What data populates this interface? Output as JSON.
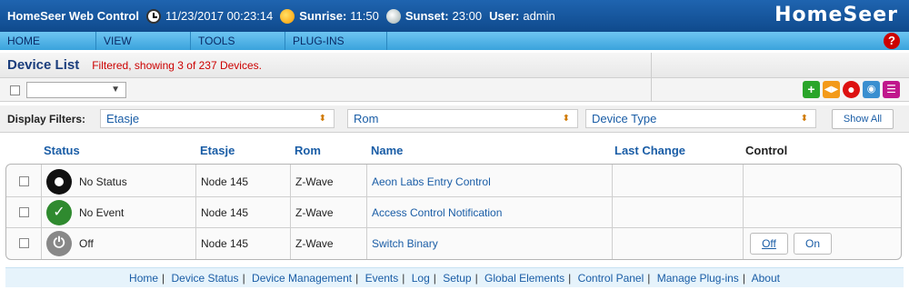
{
  "top": {
    "app_title": "HomeSeer Web Control",
    "datetime": "11/23/2017 00:23:14",
    "sunrise_label": "Sunrise:",
    "sunrise_value": "11:50",
    "sunset_label": "Sunset:",
    "sunset_value": "23:00",
    "user_label": "User:",
    "user_value": "admin",
    "logo": "HomeSeer"
  },
  "menu": {
    "items": [
      {
        "label": "HOME"
      },
      {
        "label": "VIEW"
      },
      {
        "label": "TOOLS"
      },
      {
        "label": "PLUG-INS"
      }
    ],
    "help_icon": "?"
  },
  "device_list": {
    "title": "Device List",
    "filter_text": "Filtered, showing 3 of 237 Devices."
  },
  "filters": {
    "label": "Display Filters:",
    "etasje": "Etasje",
    "rom": "Rom",
    "device_type": "Device Type",
    "show_all": "Show All"
  },
  "table": {
    "headers": {
      "status": "Status",
      "etasje": "Etasje",
      "rom": "Rom",
      "name": "Name",
      "last_change": "Last Change",
      "control": "Control"
    },
    "rows": [
      {
        "status": "No Status",
        "etasje": "Node 145",
        "rom": "Z-Wave",
        "name": "Aeon Labs Entry Control",
        "icon": "gear-icon"
      },
      {
        "status": "No Event",
        "etasje": "Node 145",
        "rom": "Z-Wave",
        "name": "Access Control Notification",
        "icon": "check-icon"
      },
      {
        "status": "Off",
        "etasje": "Node 145",
        "rom": "Z-Wave",
        "name": "Switch Binary",
        "icon": "power-icon",
        "controls": {
          "off": "Off",
          "on": "On"
        }
      }
    ]
  },
  "footer": {
    "links": [
      "Home",
      "Device Status",
      "Device Management",
      "Events",
      "Log",
      "Setup",
      "Global Elements",
      "Control Panel",
      "Manage Plug-ins",
      "About"
    ]
  }
}
